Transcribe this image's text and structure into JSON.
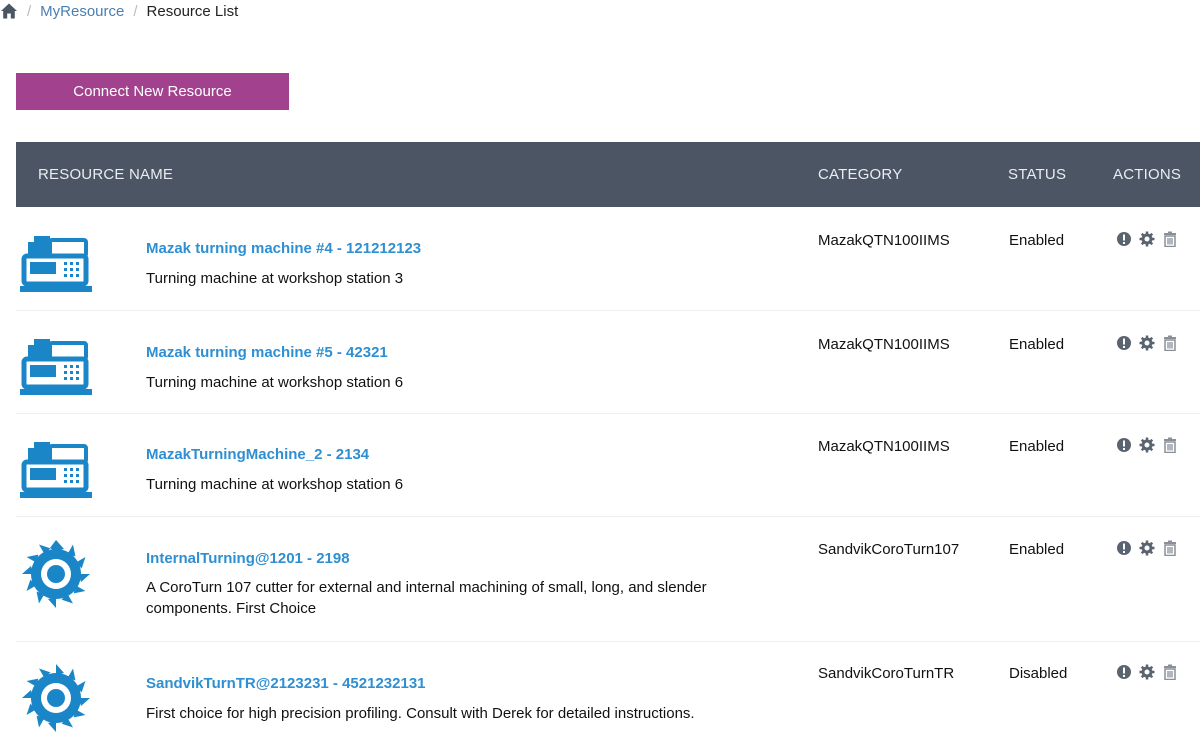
{
  "breadcrumb": {
    "home_icon": "home-icon",
    "items": [
      "MyResource",
      "Resource List"
    ]
  },
  "toolbar": {
    "connect_label": "Connect New Resource"
  },
  "table": {
    "headers": {
      "name": "RESOURCE NAME",
      "category": "CATEGORY",
      "status": "STATUS",
      "actions": "ACTIONS"
    },
    "rows": [
      {
        "icon": "turning-machine-icon",
        "title": "Mazak turning machine #4 - 121212123",
        "description": "Turning machine at workshop station 3",
        "category": "MazakQTN100IIMS",
        "status": "Enabled"
      },
      {
        "icon": "turning-machine-icon",
        "title": "Mazak turning machine #5 - 42321",
        "description": "Turning machine at workshop station 6",
        "category": "MazakQTN100IIMS",
        "status": "Enabled"
      },
      {
        "icon": "turning-machine-icon",
        "title": "MazakTurningMachine_2 - 2134",
        "description": "Turning machine at workshop station 6",
        "category": "MazakQTN100IIMS",
        "status": "Enabled"
      },
      {
        "icon": "cutter-blade-icon",
        "title": "InternalTurning@1201 - 2198",
        "description": "A CoroTurn 107 cutter for external and internal machining of small, long, and slender components. First Choice",
        "category": "SandvikCoroTurn107",
        "status": "Enabled"
      },
      {
        "icon": "cutter-blade-icon",
        "title": "SandvikTurnTR@2123231 - 4521232131",
        "description": "First choice for high precision profiling. Consult with Derek for detailed instructions.",
        "category": "SandvikCoroTurnTR",
        "status": "Disabled"
      }
    ],
    "action_icons": [
      "info-icon",
      "gear-icon",
      "trash-icon"
    ]
  },
  "colors": {
    "accent": "#a2428f",
    "header_bg": "#4b5563",
    "link": "#2e8fd2",
    "icon_blue": "#1a86c8"
  }
}
